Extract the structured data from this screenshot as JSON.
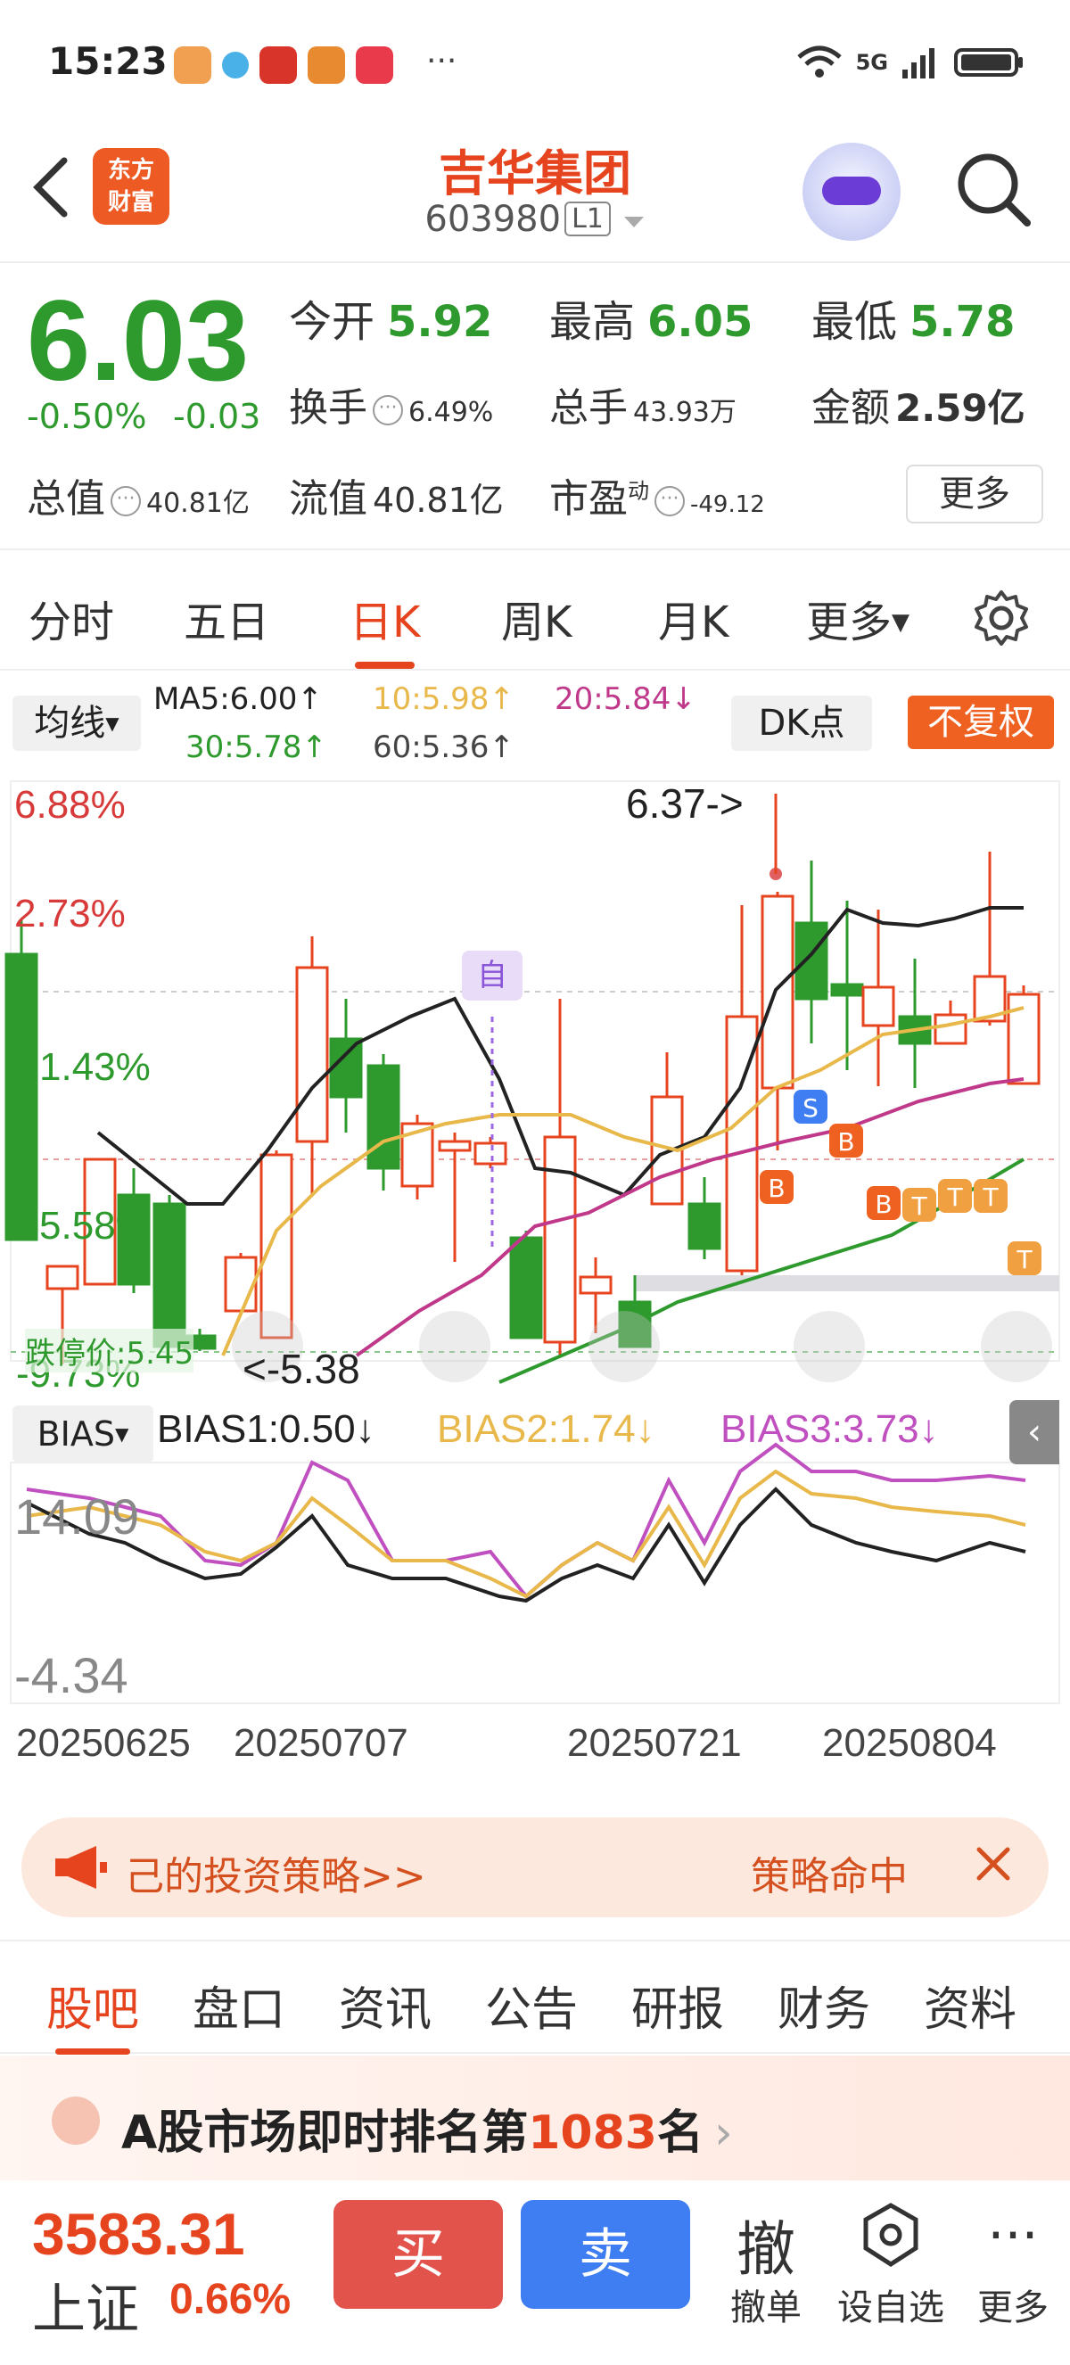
{
  "status": {
    "time": "15:23",
    "dots": "···",
    "network": "5G"
  },
  "header": {
    "brand_line1": "东方",
    "brand_line2": "财富",
    "stock_name": "吉华集团",
    "stock_code": "603980",
    "level": "L1"
  },
  "quote": {
    "price": "6.03",
    "change_pct": "-0.50%",
    "change": "-0.03",
    "open_label": "今开",
    "open": "5.92",
    "high_label": "最高",
    "high": "6.05",
    "low_label": "最低",
    "low": "5.78",
    "turnover_label": "换手",
    "turnover": "6.49%",
    "volume_label": "总手",
    "volume": "43.93万",
    "amount_label": "金额",
    "amount": "2.59亿",
    "mktcap_label": "总值",
    "mktcap": "40.81亿",
    "float_label": "流值",
    "float": "40.81亿",
    "pe_label": "市盈",
    "pe_sup": "动",
    "pe": "-49.12",
    "more": "更多"
  },
  "ktabs": [
    "分时",
    "五日",
    "日K",
    "周K",
    "月K",
    "更多"
  ],
  "ktab_active": 2,
  "ma": {
    "button": "均线",
    "ma5": "MA5:6.00↑",
    "ma10": "10:5.98↑",
    "ma20": "20:5.84↓",
    "ma30": "30:5.78↑",
    "ma60": "60:5.36↑",
    "dk": "DK点",
    "adjust": "不复权"
  },
  "chart": {
    "y_labels": [
      "6.88%",
      "2.73%",
      "1.43%",
      "5.58%",
      "-9.73%"
    ],
    "high_marker": "6.37->",
    "low_marker": "<-5.38",
    "limit_down": "跌停价:5.45",
    "tag_self": "自",
    "signals": [
      "S",
      "B",
      "B",
      "B",
      "T",
      "T",
      "T",
      "T"
    ]
  },
  "bias": {
    "button": "BIAS",
    "bias1": "BIAS1:0.50↓",
    "bias2": "BIAS2:1.74↓",
    "bias3": "BIAS3:3.73↓",
    "top": "14.09",
    "bottom": "-4.34"
  },
  "dates": [
    "20250625",
    "20250707",
    "20250721",
    "20250804"
  ],
  "banner": {
    "text": "己的投资策略>>",
    "hit": "策略命中"
  },
  "btabs": [
    "股吧",
    "盘口",
    "资讯",
    "公告",
    "研报",
    "财务",
    "资料"
  ],
  "btab_active": 0,
  "rank": {
    "prefix": "A股市场即时排名第",
    "num": "1083",
    "suffix": "名"
  },
  "bottom": {
    "index_value": "3583.31",
    "index_name": "上证",
    "index_pct": "0.66%",
    "buy": "买",
    "sell": "卖",
    "cancel_icon": "撤",
    "cancel": "撤单",
    "watch": "设自选",
    "more": "更多"
  },
  "colors": {
    "up": "#e6441e",
    "down": "#2e9a2e",
    "ma10": "#e8b84a",
    "ma20": "#c0388a",
    "ma30": "#2e9a2e",
    "bias3": "#c050c0"
  }
}
